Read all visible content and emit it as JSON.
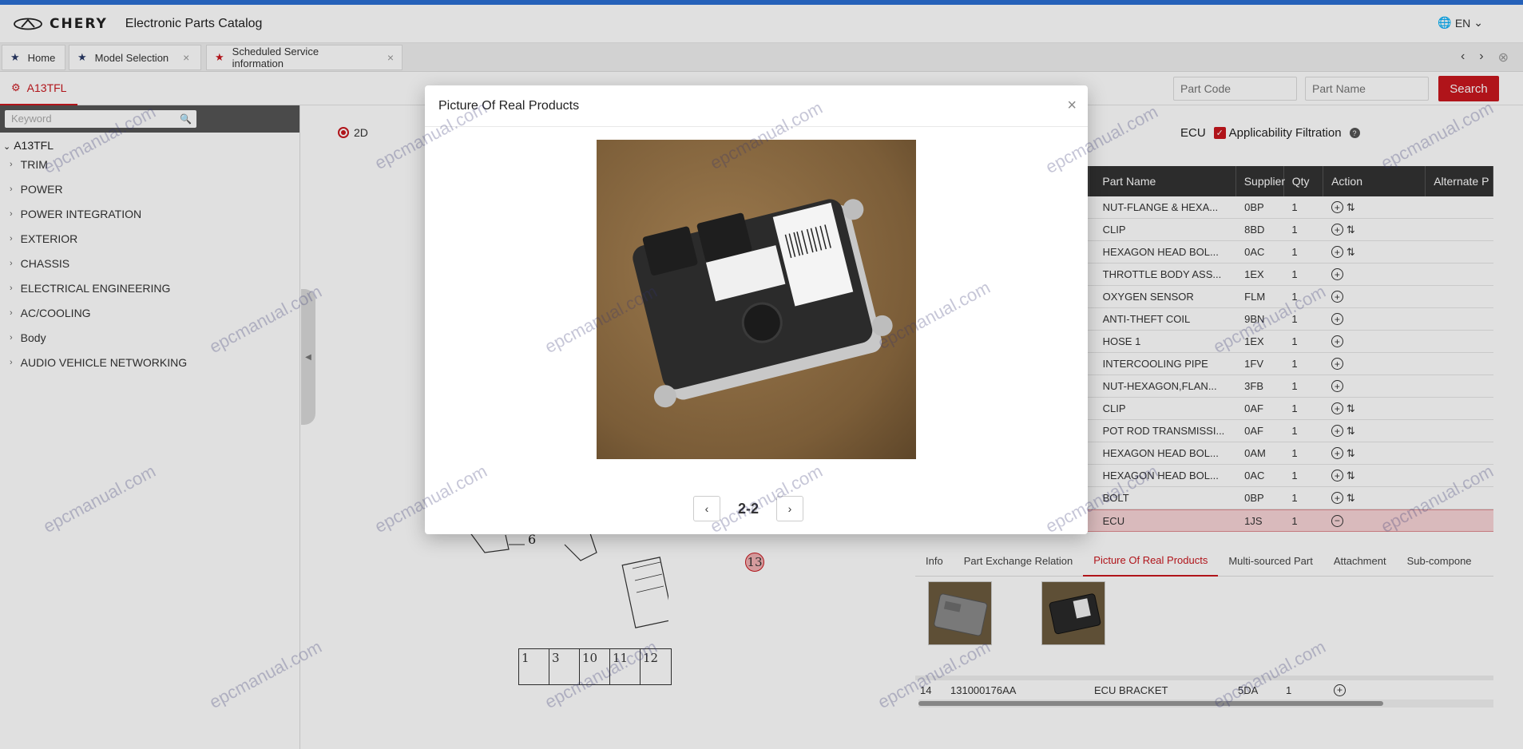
{
  "app": {
    "brand": "CHERY",
    "title": "Electronic Parts Catalog",
    "language": "EN"
  },
  "tabs": [
    {
      "label": "Home"
    },
    {
      "label": "Model Selection"
    },
    {
      "label": "Scheduled Service information"
    }
  ],
  "model_tab": "A13TFL",
  "search": {
    "part_code_placeholder": "Part Code",
    "part_name_placeholder": "Part Name",
    "button": "Search"
  },
  "sidebar": {
    "keyword_placeholder": "Keyword",
    "root": "A13TFL",
    "items": [
      "TRIM",
      "POWER",
      "POWER INTEGRATION",
      "EXTERIOR",
      "CHASSIS",
      "ELECTRICAL ENGINEERING",
      "AC/COOLING",
      "Body",
      "AUDIO VEHICLE NETWORKING"
    ]
  },
  "diagram": {
    "view_mode": "2D",
    "label_6": "6",
    "callout": "13",
    "legend": [
      "1",
      "3",
      "10",
      "11",
      "12"
    ]
  },
  "filter": {
    "part_label": "ECU",
    "applicability": "Applicability Filtration"
  },
  "parts_table": {
    "headers": {
      "name": "Part Name",
      "supplier": "Supplier",
      "qty": "Qty",
      "action": "Action",
      "alt": "Alternate P"
    },
    "rows": [
      {
        "name": "NUT-FLANGE & HEXA...",
        "supplier": "0BP",
        "qty": "1",
        "swap": true
      },
      {
        "name": "CLIP",
        "supplier": "8BD",
        "qty": "1",
        "swap": true
      },
      {
        "name": "HEXAGON HEAD BOL...",
        "supplier": "0AC",
        "qty": "1",
        "swap": true
      },
      {
        "name": "THROTTLE BODY ASS...",
        "supplier": "1EX",
        "qty": "1",
        "swap": false
      },
      {
        "name": "OXYGEN SENSOR",
        "supplier": "FLM",
        "qty": "1",
        "swap": false
      },
      {
        "name": "ANTI-THEFT COIL",
        "supplier": "9BN",
        "qty": "1",
        "swap": false
      },
      {
        "name": "HOSE 1",
        "supplier": "1EX",
        "qty": "1",
        "swap": false
      },
      {
        "name": "INTERCOOLING PIPE",
        "supplier": "1FV",
        "qty": "1",
        "swap": false
      },
      {
        "name": "NUT-HEXAGON,FLAN...",
        "supplier": "3FB",
        "qty": "1",
        "swap": false
      },
      {
        "name": "CLIP",
        "supplier": "0AF",
        "qty": "1",
        "swap": true
      },
      {
        "name": "POT ROD TRANSMISSI...",
        "supplier": "0AF",
        "qty": "1",
        "swap": true
      },
      {
        "name": "HEXAGON HEAD BOL...",
        "supplier": "0AM",
        "qty": "1",
        "swap": true
      },
      {
        "name": "HEXAGON HEAD BOL...",
        "supplier": "0AC",
        "qty": "1",
        "swap": true
      },
      {
        "name": "BOLT",
        "supplier": "0BP",
        "qty": "1",
        "swap": true
      },
      {
        "name": "ECU",
        "supplier": "1JS",
        "qty": "1",
        "swap": false,
        "selected": true
      }
    ]
  },
  "detail_tabs": [
    "Info",
    "Part Exchange Relation",
    "Picture Of Real Products",
    "Multi-sourced Part",
    "Attachment",
    "Sub-compone"
  ],
  "bottom_row": {
    "index": "14",
    "code": "131000176AA",
    "name": "ECU BRACKET",
    "supplier": "5DA",
    "qty": "1"
  },
  "modal": {
    "title": "Picture Of Real Products",
    "pager": "2-2"
  },
  "watermark": "epcmanual.com",
  "colors": {
    "accent": "#c9171e",
    "topbar": "#2b6fd3"
  }
}
